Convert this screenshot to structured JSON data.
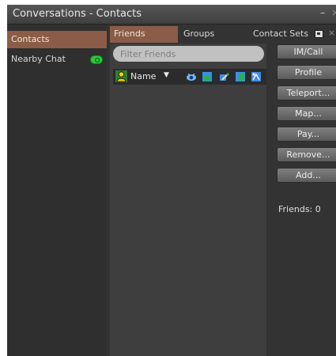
{
  "window": {
    "title": "Conversations - Contacts",
    "minimize_glyph": "–",
    "close_glyph": "×"
  },
  "conversations": [
    {
      "label": "Contacts",
      "selected": true
    },
    {
      "label": "Nearby Chat",
      "icon": "voice-active-icon",
      "icon_color": "#2dc93b"
    }
  ],
  "tabs": [
    {
      "label": "Friends",
      "selected": true
    },
    {
      "label": "Groups"
    },
    {
      "label": "Contact Sets",
      "icon": "popout-icon",
      "close_glyph": "×"
    }
  ],
  "filter": {
    "placeholder": "Filter Friends",
    "value": ""
  },
  "sort": {
    "label": "Name",
    "arrow": "▼",
    "column_icons": [
      "online-status-icon",
      "see-on-map-icon",
      "edit-objects-icon",
      "modify-objects-icon",
      "see-online-icon"
    ]
  },
  "actions": [
    {
      "label": "IM/Call"
    },
    {
      "label": "Profile"
    },
    {
      "label": "Teleport..."
    },
    {
      "label": "Map..."
    },
    {
      "label": "Pay..."
    },
    {
      "label": "Remove..."
    },
    {
      "label": "Add..."
    }
  ],
  "friend_count": "Friends: 0",
  "colors": {
    "accent": "#8b5d48",
    "window_bg": "#333333",
    "pane_bg": "#3e3e3e",
    "button_top": "#7f7f7f",
    "button_bottom": "#5c5c5c",
    "voice_green": "#2dc93b"
  }
}
